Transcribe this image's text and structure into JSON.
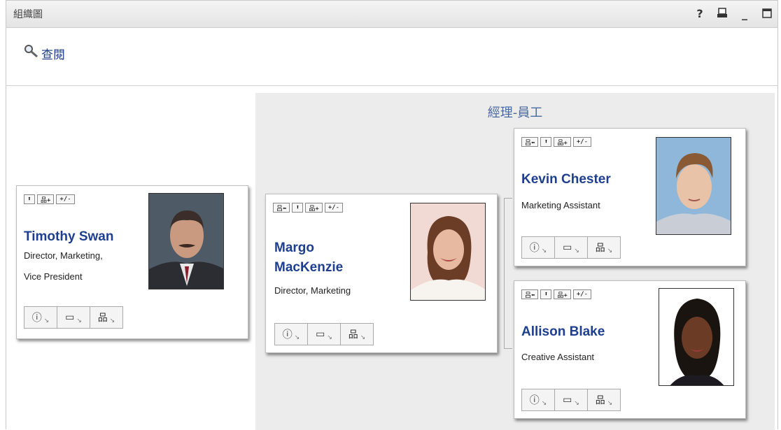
{
  "titlebar": {
    "title": "組織圖",
    "icons": [
      "help-icon",
      "print-icon",
      "minimize-icon",
      "maximize-icon"
    ],
    "help": "?",
    "minimize": "_"
  },
  "lookup": {
    "label": "查閱",
    "icon": "magnifier-icon"
  },
  "manager_area": {
    "title": "經理-員工"
  },
  "toolbar_labels": {
    "up": "⬆",
    "org": "品+",
    "toggle": "+/-",
    "back": "吕⬅"
  },
  "action_icons": {
    "info": "ⓘ",
    "email": "▭",
    "org": "品"
  },
  "people": {
    "timothy": {
      "name": "Timothy Swan",
      "title_line1": "Director, Marketing,",
      "title_line2": "Vice President"
    },
    "margo": {
      "name_line1": "Margo",
      "name_line2": "MacKenzie",
      "title": "Director, Marketing"
    },
    "kevin": {
      "name": "Kevin Chester",
      "title": "Marketing Assistant"
    },
    "allison": {
      "name": "Allison Blake",
      "title": "Creative Assistant"
    }
  },
  "colors": {
    "name_link": "#1e3f8f",
    "manager_area_bg": "#ececec",
    "manager_title": "#4a6a9e"
  }
}
